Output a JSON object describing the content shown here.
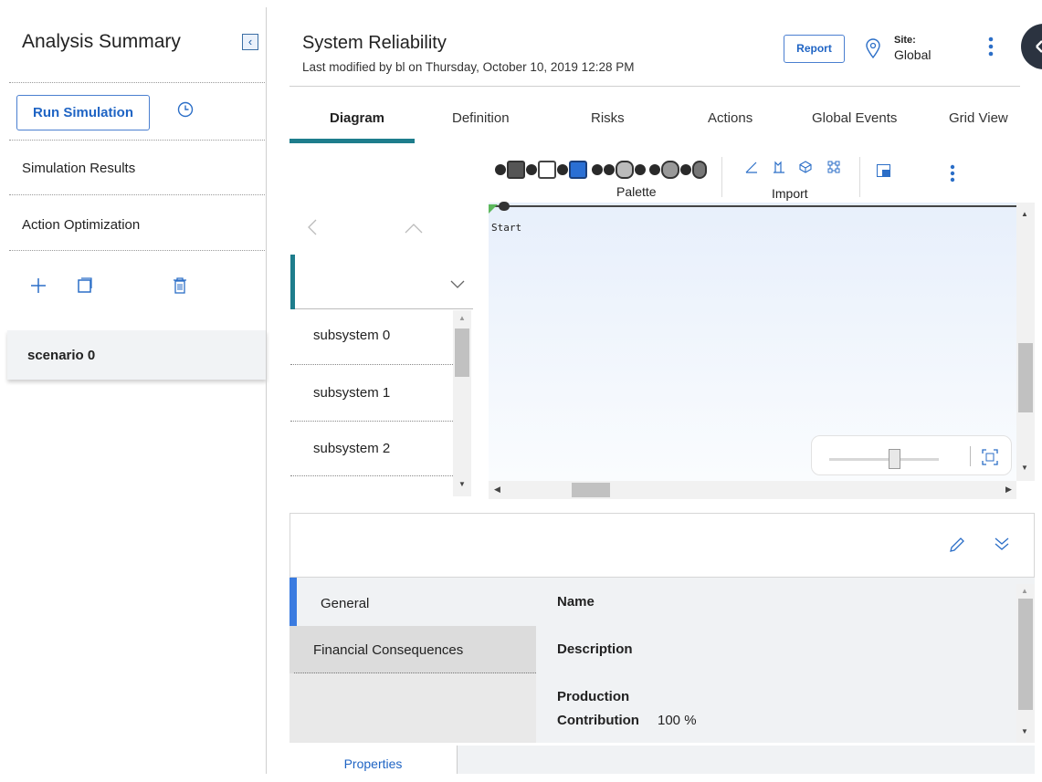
{
  "sidebar": {
    "title": "Analysis Summary",
    "run_simulation": "Run Simulation",
    "items": [
      "Simulation Results",
      "Action Optimization"
    ],
    "scenario": "scenario 0"
  },
  "header": {
    "title": "System Reliability",
    "subtitle": "Last modified by bl on Thursday, October 10, 2019 12:28 PM",
    "report": "Report",
    "site_label": "Site:",
    "site_value": "Global"
  },
  "tabs": [
    "Diagram",
    "Definition",
    "Risks",
    "Actions",
    "Global Events",
    "Grid View"
  ],
  "active_tab": "Diagram",
  "toolbar": {
    "palette": "Palette",
    "import": "Import"
  },
  "diagram": {
    "start_label": "Start"
  },
  "subsystems": [
    "subsystem 0",
    "subsystem 1",
    "subsystem 2"
  ],
  "details": {
    "nav": [
      "General",
      "Financial Consequences"
    ],
    "fields": {
      "name": "Name",
      "description": "Description",
      "production": "Production",
      "contribution": "Contribution",
      "contribution_value": "100 %"
    },
    "bottom_tab": "Properties"
  },
  "colors": {
    "accent": "#1e7d8c",
    "link": "#1f64c4",
    "nav_accent": "#3a7be0"
  }
}
